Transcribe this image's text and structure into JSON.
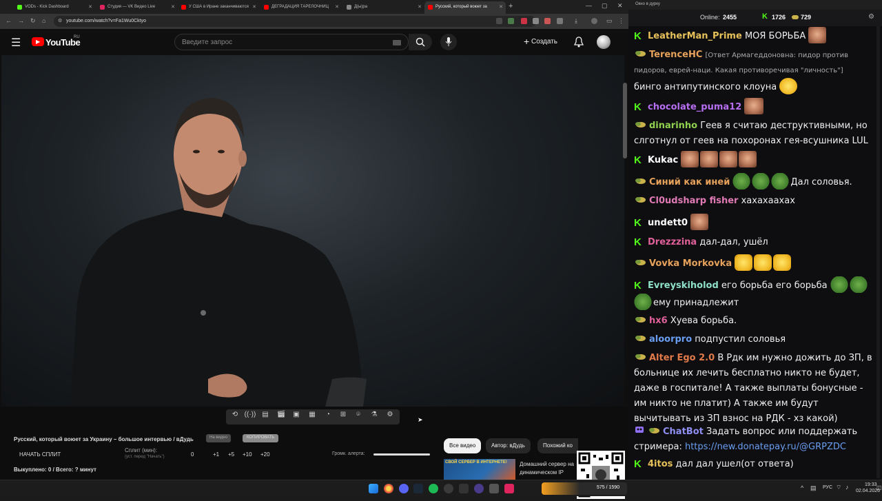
{
  "browser": {
    "tabs": [
      {
        "label": "VODs - Kick Dashboard",
        "color": "#53fc18"
      },
      {
        "label": "Студия — VK Видео Live",
        "color": "#e0245e"
      },
      {
        "label": "У США в Иране заканчиваются",
        "color": "#ff0000"
      },
      {
        "label": "ДЕГРАДАЦИЯ ТАРЕЛОЧНИЦ",
        "color": "#ff0000"
      },
      {
        "label": "Д(ы)ра",
        "color": "#888888"
      },
      {
        "label": "Русский, который воюет за",
        "color": "#ff0000"
      }
    ],
    "url": "youtube.com/watch?v=Fa1Wu0Cktyo"
  },
  "youtube": {
    "logo": "YouTube",
    "region": "RU",
    "search_placeholder": "Введите запрос",
    "create_label": "Создать"
  },
  "panel": {
    "title": "Русский, который воюет за Украину – большое интервью / вДудь",
    "chip_on_video": "На видео",
    "chip_copy": "КОПИРОВАТЬ",
    "start_split": "НАЧАТЬ СПЛИТ",
    "split_label": "Сплит (мин):",
    "split_hint": "(уст. перед \"Начать\")",
    "split_values": [
      "0",
      "+1",
      "+5",
      "+10",
      "+20"
    ],
    "volume_label": "Громк. алерта:",
    "volume_level": 1.0,
    "bought": "Выкуплено: 0 / Всего: ? минут",
    "filter_all": "Все видео",
    "filter_author": "Автор: вДудь",
    "filter_similar": "Похожий ко",
    "ad_title": "СВОЙ СЕРВЕР В ИНТЕРНЕТЕ!",
    "ad_text": "Домашний сервер на динамическом IP бесплатно!"
  },
  "chat": {
    "window_title": "Окно в дурку",
    "online_label": "Online:",
    "online_count": "2455",
    "kick_count": "1726",
    "other_count": "729",
    "messages": [
      {
        "badge": "kick",
        "user": "LeatherMan_Prime",
        "color": "#e6c15a",
        "text": "МОЯ БОРЬБА",
        "emotes": "face1"
      },
      {
        "badge": "sub",
        "user": "TerenceHC",
        "color": "#e6a15a",
        "reply": "[Ответ Армагеддоновна: пидор против пидоров, еврей-наци. Какая противоречивая \"личность\"]",
        "text": "бинго антипутинского клоуна"
      },
      {
        "badge": "kick",
        "user": "chocolate_puma12",
        "color": "#b66ef2",
        "text": ""
      },
      {
        "badge": "sub",
        "user": "dinarinho",
        "color": "#8fd14f",
        "text": "Геев я считаю деструктивными, но слготнул от геев на похоронах гея-всушника LUL"
      },
      {
        "badge": "kick",
        "user": "Kukac",
        "color": "#ffffff",
        "text": ""
      },
      {
        "badge": "sub",
        "user": "Синий как иней",
        "color": "#e6a15a",
        "text": "Дал соловья."
      },
      {
        "badge": "sub",
        "user": "Cl0udsharp fisher",
        "color": "#e07ab5",
        "text": "хахахаахах"
      },
      {
        "badge": "kick",
        "user": "undett0",
        "color": "#ffffff",
        "text": ""
      },
      {
        "badge": "kick",
        "user": "Drezzzina",
        "color": "#e0609a",
        "text": "дал-дал, ушёл"
      },
      {
        "badge": "sub",
        "user": "Vovka Morkovka",
        "color": "#e6a15a",
        "text": ""
      },
      {
        "badge": "kick",
        "user": "Evreyskiholod",
        "color": "#8fe0c8",
        "text": "его борьба его борьба",
        "text2": "ему принадлежит"
      },
      {
        "badge": "sub",
        "user": "hx6",
        "color": "#e0609a",
        "text": "Хуева борьба."
      },
      {
        "badge": "sub",
        "user": "aloorpro",
        "color": "#6a9ef2",
        "text": "подпустил соловья"
      },
      {
        "badge": "sub",
        "user": "Alter Ego 2.0",
        "color": "#e07a4a",
        "text": "В Рдк им нужно дожить до ЗП, в больнице их лечить бесплатно никто не будет, даже в госпитале! А также выплаты бонусные - им никто не платит) А также им будут вычитывать из ЗП взнос на РДК - хз какой)"
      },
      {
        "badge": "bot",
        "user": "ChatBot",
        "color": "#8f8ff2",
        "text": "Задать вопрос или поддержать стримера:",
        "link": "https://new.donatepay.ru/@GRPZDC"
      },
      {
        "badge": "kick",
        "user": "4itos",
        "color": "#e6c15a",
        "text": "дал дал ушел(от ответа)"
      }
    ]
  },
  "taskbar": {
    "lang": "РУС",
    "time": "19:33",
    "date": "02.04.2026",
    "widget": "575 / 1590"
  }
}
